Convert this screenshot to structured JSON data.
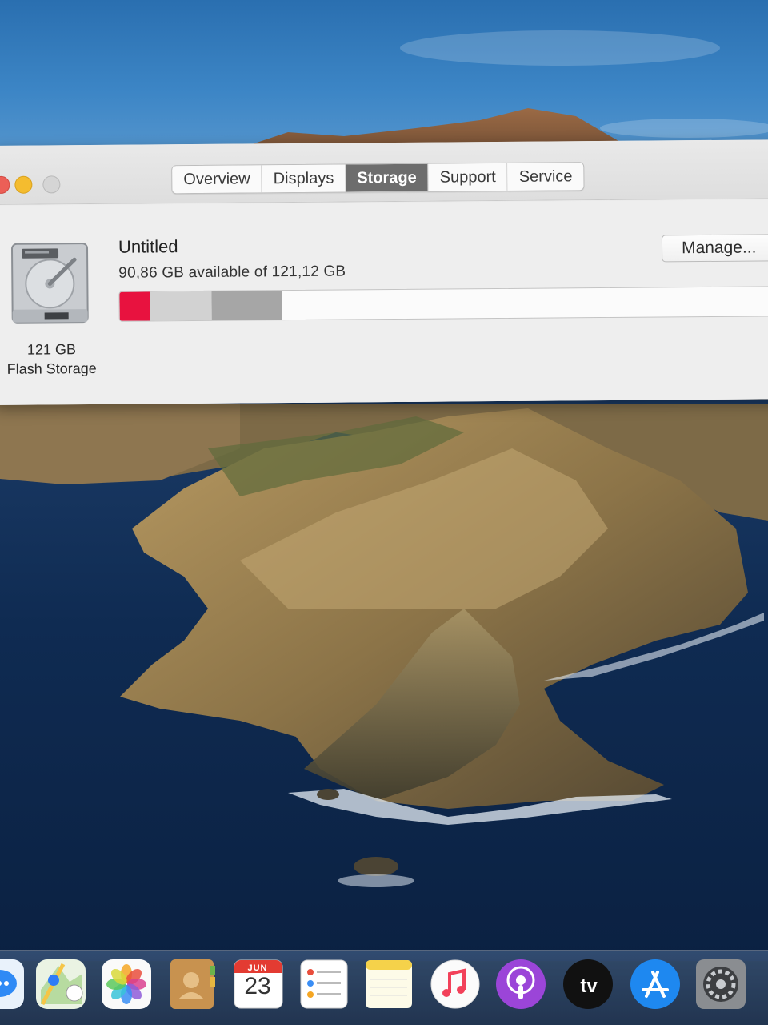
{
  "window": {
    "tabs": [
      {
        "label": "Overview",
        "active": false
      },
      {
        "label": "Displays",
        "active": false
      },
      {
        "label": "Storage",
        "active": true
      },
      {
        "label": "Support",
        "active": false
      },
      {
        "label": "Service",
        "active": false
      }
    ]
  },
  "storage": {
    "disk_size": "121 GB",
    "disk_type": "Flash Storage",
    "volume_name": "Untitled",
    "availability": "90,86 GB available of 121,12 GB",
    "manage_label": "Manage...",
    "usage_segments": [
      {
        "name": "segment-apps",
        "fraction": 0.045,
        "color": "#e8123f"
      },
      {
        "name": "segment-documents",
        "fraction": 0.092,
        "color": "#d2d2d2"
      },
      {
        "name": "segment-system",
        "fraction": 0.105,
        "color": "#a6a6a6"
      }
    ]
  },
  "dock": {
    "items": [
      {
        "name": "messages-icon"
      },
      {
        "name": "maps-icon"
      },
      {
        "name": "photos-icon"
      },
      {
        "name": "contacts-icon"
      },
      {
        "name": "calendar-icon",
        "month": "JUN",
        "day": "23"
      },
      {
        "name": "reminders-icon"
      },
      {
        "name": "notes-icon"
      },
      {
        "name": "music-icon"
      },
      {
        "name": "podcasts-icon"
      },
      {
        "name": "apple-tv-icon",
        "label": "tv"
      },
      {
        "name": "app-store-icon"
      },
      {
        "name": "system-preferences-icon"
      }
    ]
  }
}
